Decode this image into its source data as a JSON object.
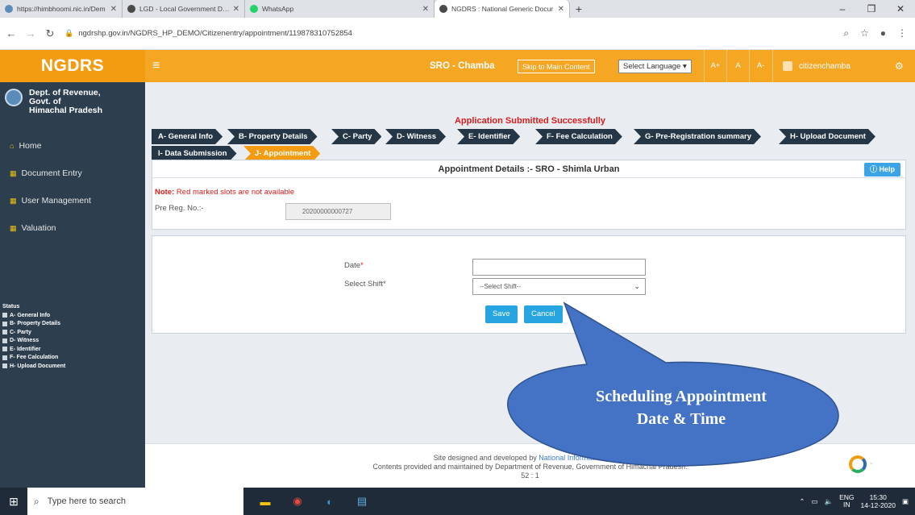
{
  "browser": {
    "tabs": [
      {
        "title": "https://himbhoomi.nic.in/Dem",
        "color": "#5b8bb8",
        "active": false
      },
      {
        "title": "LGD - Local Government Directo",
        "color": "#4a4a4a",
        "active": false
      },
      {
        "title": "WhatsApp",
        "color": "#25d366",
        "active": false
      },
      {
        "title": "NGDRS : National Generic Docur",
        "color": "#4a4a4a",
        "active": true
      }
    ],
    "new_tab": "+",
    "url": "ngdrshp.gov.in/NGDRS_HP_DEMO/Citizenentry/appointment/119878310752854",
    "window_controls": [
      "–",
      "❐",
      "✕"
    ]
  },
  "header": {
    "logo": "NGDRS",
    "menu_icon": "≡",
    "sro": "SRO - Chamba",
    "skip": "Skip to Main Content",
    "language": "Select Language ▾",
    "font_sizes": [
      "A+",
      "A",
      "A-"
    ],
    "user": "citizenchamba",
    "settings_icon": "⚙"
  },
  "sidebar": {
    "dept": [
      "Dept. of Revenue,",
      "Govt. of",
      "Himachal Pradesh"
    ],
    "menu": [
      {
        "label": "Home",
        "icon": "home-icon"
      },
      {
        "label": "Document Entry",
        "icon": "grid-icon"
      },
      {
        "label": "User Management",
        "icon": "grid-icon"
      },
      {
        "label": "Valuation",
        "icon": "grid-icon"
      }
    ],
    "status_title": "Status",
    "status_items": [
      "A- General Info",
      "B- Property Details",
      "C- Party",
      "D- Witness",
      "E- Identifier",
      "F- Fee Calculation",
      "H- Upload Document"
    ]
  },
  "main": {
    "success": "Application Submitted Successfully",
    "steps": [
      "A- General Info",
      "B- Property Details",
      "C- Party",
      "D- Witness",
      "E- Identifier",
      "F- Fee Calculation",
      "G- Pre-Registration summary",
      "H- Upload Document",
      "I- Data Submission",
      "J- Appointment"
    ],
    "panel_title": "Appointment Details :- SRO - Shimla Urban",
    "help": "Help",
    "note_label": "Note:",
    "note_text": "Red marked slots are not available",
    "prereg_label": "Pre Reg. No.:-",
    "prereg_value": "20200000000727",
    "date_label": "Date",
    "shift_label": "Select Shift",
    "shift_placeholder": "--Select Shift--",
    "save": "Save",
    "cancel": "Cancel"
  },
  "footer": {
    "line1_prefix": "Site designed and developed by",
    "line1_link": "National Informatics Centre",
    "line2": "Contents provided and maintained by Department of Revenue, Government of Himachal Pradesh.",
    "line3": "52 : 1"
  },
  "callout": {
    "line1": "Scheduling Appointment",
    "line2": "Date & Time",
    "fill": "#4472c4"
  },
  "taskbar": {
    "search": "Type here to search",
    "lang1": "ENG",
    "lang2": "IN",
    "time": "15:30",
    "date": "14-12-2020"
  }
}
